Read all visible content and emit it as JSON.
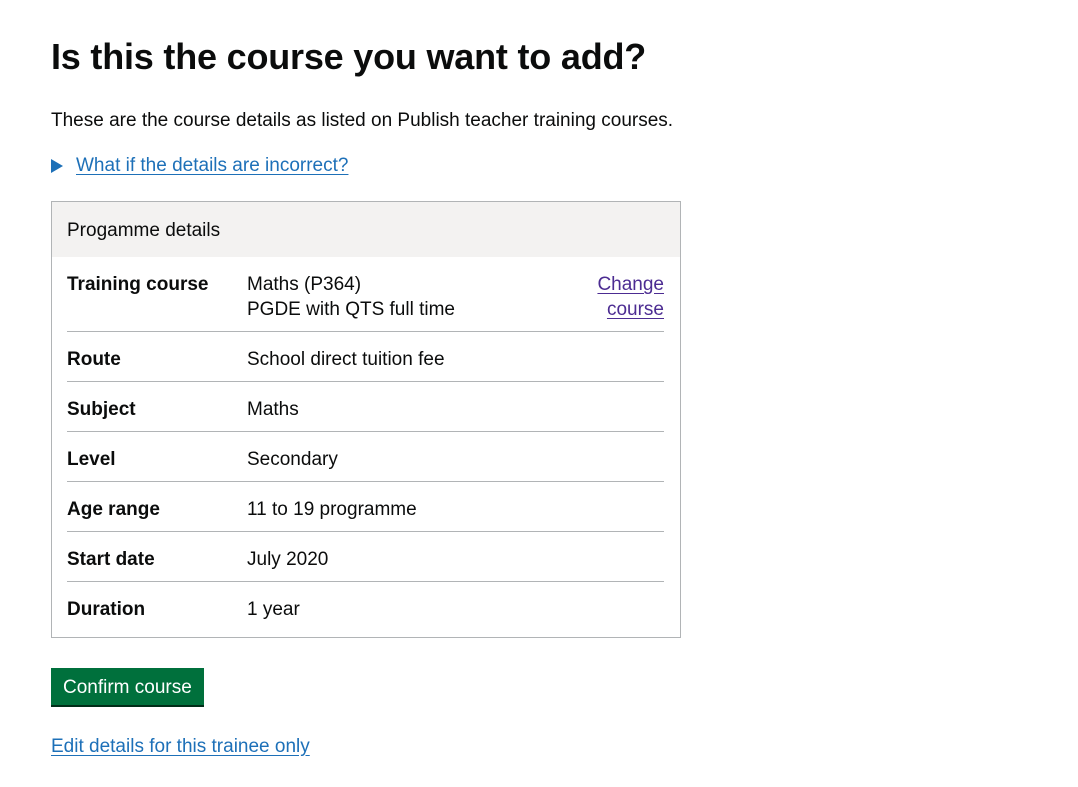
{
  "page": {
    "title": "Is this the course you want to add?",
    "lede": "These are the course details as listed on Publish teacher training courses."
  },
  "details_toggle": {
    "label": "What if the details are incorrect?"
  },
  "summary_card": {
    "header": "Progamme details",
    "rows": [
      {
        "key": "Training course",
        "value_line1": "Maths (P364)",
        "value_line2": "PGDE with QTS full time",
        "action_line1": "Change",
        "action_line2": "course"
      },
      {
        "key": "Route",
        "value": "School direct tuition fee"
      },
      {
        "key": "Subject",
        "value": "Maths"
      },
      {
        "key": "Level",
        "value": "Secondary"
      },
      {
        "key": "Age range",
        "value": "11 to 19 programme"
      },
      {
        "key": "Start date",
        "value": "July 2020"
      },
      {
        "key": "Duration",
        "value": "1 year"
      }
    ]
  },
  "actions": {
    "confirm_label": "Confirm course",
    "edit_link": "Edit details for this trainee only"
  },
  "colors": {
    "text": "#0b0c0c",
    "link": "#1d70b8",
    "visited_link": "#4c2c92",
    "button": "#00703c",
    "header_bg": "#f3f2f1",
    "border": "#b1b4b6"
  }
}
